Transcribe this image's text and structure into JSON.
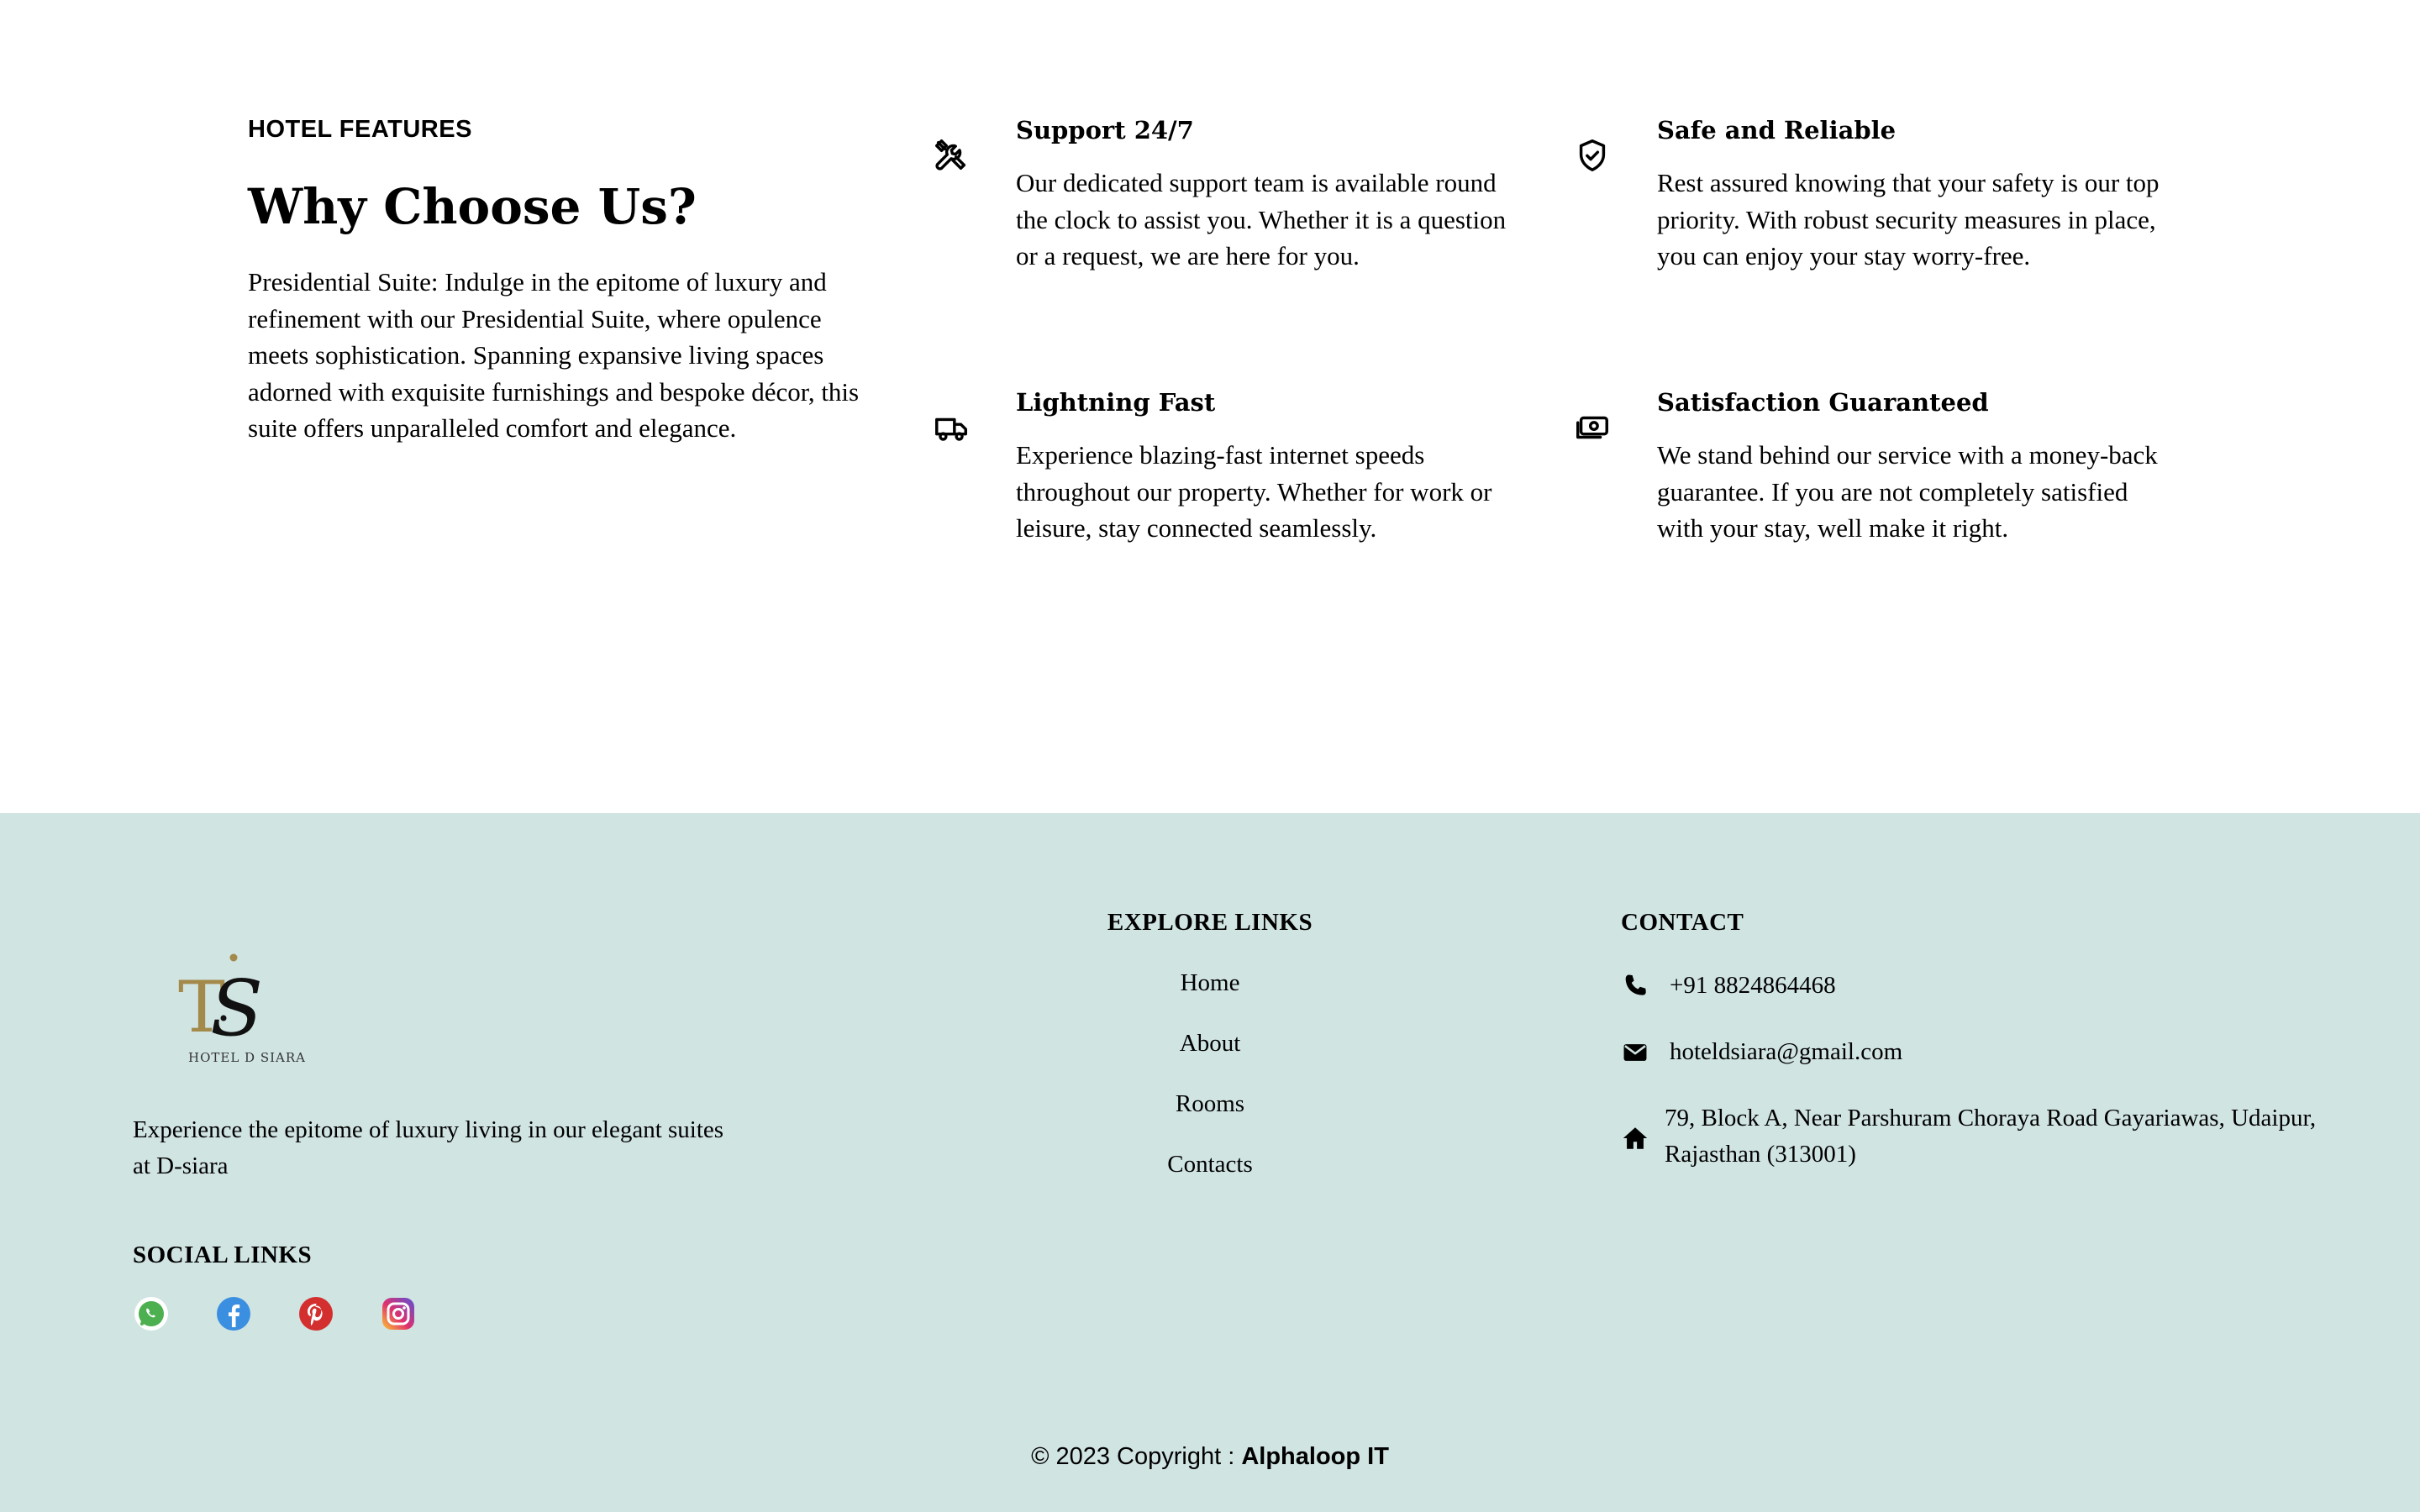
{
  "features_section": {
    "eyebrow": "HOTEL FEATURES",
    "title": "Why Choose Us?",
    "description": "Presidential Suite: Indulge in the epitome of luxury and refinement with our Presidential Suite, where opulence meets sophistication. Spanning expansive living spaces adorned with exquisite furnishings and bespoke décor, this suite offers unparalleled comfort and elegance.",
    "items": [
      {
        "icon": "tools-icon",
        "title": "Support 24/7",
        "text": "Our dedicated support team is available round the clock to assist you. Whether it is a question or a request, we are here for you."
      },
      {
        "icon": "shield-check-icon",
        "title": "Safe and Reliable",
        "text": "Rest assured knowing that your safety is our top priority. With robust security measures in place, you can enjoy your stay worry-free."
      },
      {
        "icon": "truck-icon",
        "title": "Lightning Fast",
        "text": "Experience blazing-fast internet speeds throughout our property. Whether for work or leisure, stay connected seamlessly."
      },
      {
        "icon": "cash-icon",
        "title": "Satisfaction Guaranteed",
        "text": "We stand behind our service with a money-back guarantee. If you are not completely satisfied with your stay, well make it right."
      }
    ]
  },
  "footer": {
    "background": "#d0e4e2",
    "logo_text": "HOTEL D SIARA",
    "tagline": "Experience the epitome of luxury living in our elegant suites at D-siara",
    "social_title": "SOCIAL LINKS",
    "social": [
      {
        "icon": "whatsapp-icon",
        "color": "#4caf50"
      },
      {
        "icon": "facebook-icon",
        "color": "#3b8fe0"
      },
      {
        "icon": "pinterest-icon",
        "color": "#d32f2f"
      },
      {
        "icon": "instagram-icon",
        "color": "#c13584"
      }
    ],
    "explore_title": "EXPLORE LINKS",
    "explore_links": [
      "Home",
      "About",
      "Rooms",
      "Contacts"
    ],
    "contact_title": "CONTACT",
    "contact": {
      "phone": "+91 8824864468",
      "email": "hoteldsiara@gmail.com",
      "address": "79, Block A, Near Parshuram Choraya Road Gayariawas, Udaipur, Rajasthan (313001)"
    },
    "copyright_prefix": "© 2023 Copyright : ",
    "copyright_company": "Alphaloop IT"
  }
}
